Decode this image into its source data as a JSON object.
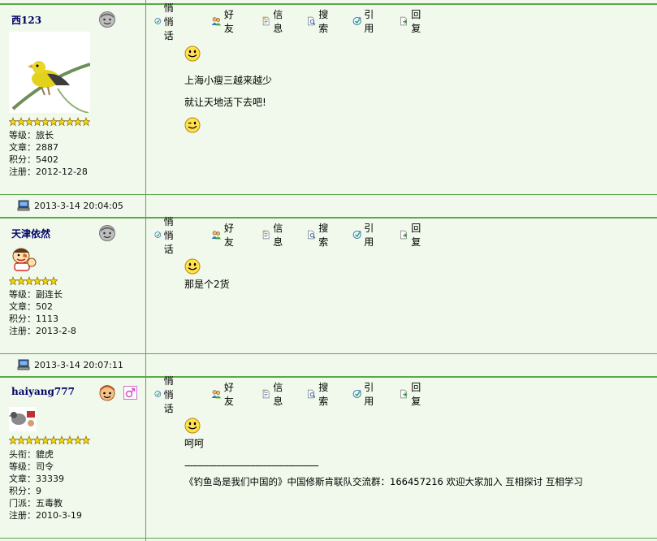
{
  "toolbar": {
    "whisper": "悄悄话",
    "friend": "好友",
    "info": "信息",
    "search": "搜索",
    "quote": "引用",
    "reply": "回复"
  },
  "posts": [
    {
      "username": "西123",
      "star_count": 10,
      "info": [
        "等级：旅长",
        "文章：2887",
        "积分：5402",
        "注册：2012-12-28"
      ],
      "content": [
        "上海小瘦三越来越少",
        "就让天地活下去吧!"
      ],
      "posted_at": "2013-3-14 20:04:05"
    },
    {
      "username": "天津依然",
      "star_count": 6,
      "info": [
        "等级：副连长",
        "文章：502",
        "积分：1113",
        "注册：2013-2-8"
      ],
      "content": [
        "那是个2货"
      ],
      "posted_at": "2013-3-14 20:07:11"
    },
    {
      "username": "haiyang777",
      "star_count": 10,
      "info": [
        "头衔：貔虎",
        "等级：司令",
        "文章：33339",
        "积分：9",
        "门派：五毒教",
        "注册：2010-3-19"
      ],
      "content": [
        "呵呵",
        "---------------------------------------------------",
        "《钓鱼岛是我们中国的》中国修斯肯联队交流群：166457216 欢迎大家加入  互相探讨   互相学习"
      ]
    }
  ],
  "colors": {
    "background": "#F0F9EB",
    "border": "#5AA94A",
    "username": "#000066",
    "star": "#F5D90A"
  },
  "icons": [
    "smiley-icon",
    "wink-icon",
    "offline-face-icon",
    "online-face-icon",
    "computer-icon",
    "star-icon"
  ]
}
